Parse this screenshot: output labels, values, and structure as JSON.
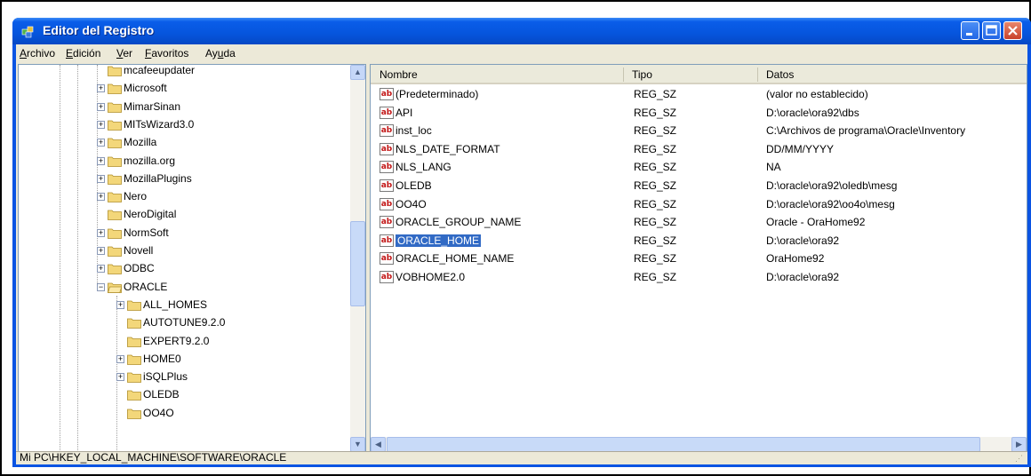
{
  "window": {
    "title": "Editor del Registro",
    "icon": "regedit-icon"
  },
  "menu": [
    {
      "pre": "",
      "u": "A",
      "post": "rchivo"
    },
    {
      "pre": "",
      "u": "E",
      "post": "dición"
    },
    {
      "pre": "",
      "u": "V",
      "post": "er"
    },
    {
      "pre": "",
      "u": "F",
      "post": "avoritos"
    },
    {
      "pre": "Ay",
      "u": "u",
      "post": "da"
    }
  ],
  "tree": [
    {
      "label": "mcafeeupdater",
      "expandable": false,
      "open": false
    },
    {
      "label": "Microsoft",
      "expandable": true,
      "open": false
    },
    {
      "label": "MimarSinan",
      "expandable": true,
      "open": false
    },
    {
      "label": "MITsWizard3.0",
      "expandable": true,
      "open": false
    },
    {
      "label": "Mozilla",
      "expandable": true,
      "open": false
    },
    {
      "label": "mozilla.org",
      "expandable": true,
      "open": false
    },
    {
      "label": "MozillaPlugins",
      "expandable": true,
      "open": false
    },
    {
      "label": "Nero",
      "expandable": true,
      "open": false
    },
    {
      "label": "NeroDigital",
      "expandable": false,
      "open": false
    },
    {
      "label": "NormSoft",
      "expandable": true,
      "open": false
    },
    {
      "label": "Novell",
      "expandable": true,
      "open": false
    },
    {
      "label": "ODBC",
      "expandable": true,
      "open": false
    },
    {
      "label": "ORACLE",
      "expandable": true,
      "open": true
    },
    {
      "label": "ALL_HOMES",
      "expandable": true,
      "open": false
    },
    {
      "label": "AUTOTUNE9.2.0",
      "expandable": false,
      "open": false
    },
    {
      "label": "EXPERT9.2.0",
      "expandable": false,
      "open": false
    },
    {
      "label": "HOME0",
      "expandable": true,
      "open": false
    },
    {
      "label": "iSQLPlus",
      "expandable": true,
      "open": false
    },
    {
      "label": "OLEDB",
      "expandable": false,
      "open": false
    },
    {
      "label": "OO4O",
      "expandable": false,
      "open": false
    }
  ],
  "columns": {
    "name": "Nombre",
    "type": "Tipo",
    "data": "Datos"
  },
  "values": [
    {
      "name": "(Predeterminado)",
      "type": "REG_SZ",
      "data": "(valor no establecido)",
      "selected": false
    },
    {
      "name": "API",
      "type": "REG_SZ",
      "data": "D:\\oracle\\ora92\\dbs",
      "selected": false
    },
    {
      "name": "inst_loc",
      "type": "REG_SZ",
      "data": "C:\\Archivos de programa\\Oracle\\Inventory",
      "selected": false
    },
    {
      "name": "NLS_DATE_FORMAT",
      "type": "REG_SZ",
      "data": "DD/MM/YYYY",
      "selected": false
    },
    {
      "name": "NLS_LANG",
      "type": "REG_SZ",
      "data": "NA",
      "selected": false
    },
    {
      "name": "OLEDB",
      "type": "REG_SZ",
      "data": "D:\\oracle\\ora92\\oledb\\mesg",
      "selected": false
    },
    {
      "name": "OO4O",
      "type": "REG_SZ",
      "data": "D:\\oracle\\ora92\\oo4o\\mesg",
      "selected": false
    },
    {
      "name": "ORACLE_GROUP_NAME",
      "type": "REG_SZ",
      "data": "Oracle - OraHome92",
      "selected": false
    },
    {
      "name": "ORACLE_HOME",
      "type": "REG_SZ",
      "data": "D:\\oracle\\ora92",
      "selected": true
    },
    {
      "name": "ORACLE_HOME_NAME",
      "type": "REG_SZ",
      "data": "OraHome92",
      "selected": false
    },
    {
      "name": "VOBHOME2.0",
      "type": "REG_SZ",
      "data": "D:\\oracle\\ora92",
      "selected": false
    }
  ],
  "value_icon": "ab",
  "status": "Mi PC\\HKEY_LOCAL_MACHINE\\SOFTWARE\\ORACLE",
  "colors": {
    "titlebar": "#0a54e3",
    "selection": "#316ac5",
    "chrome": "#ece9d8",
    "folder": "#f3d77a"
  }
}
